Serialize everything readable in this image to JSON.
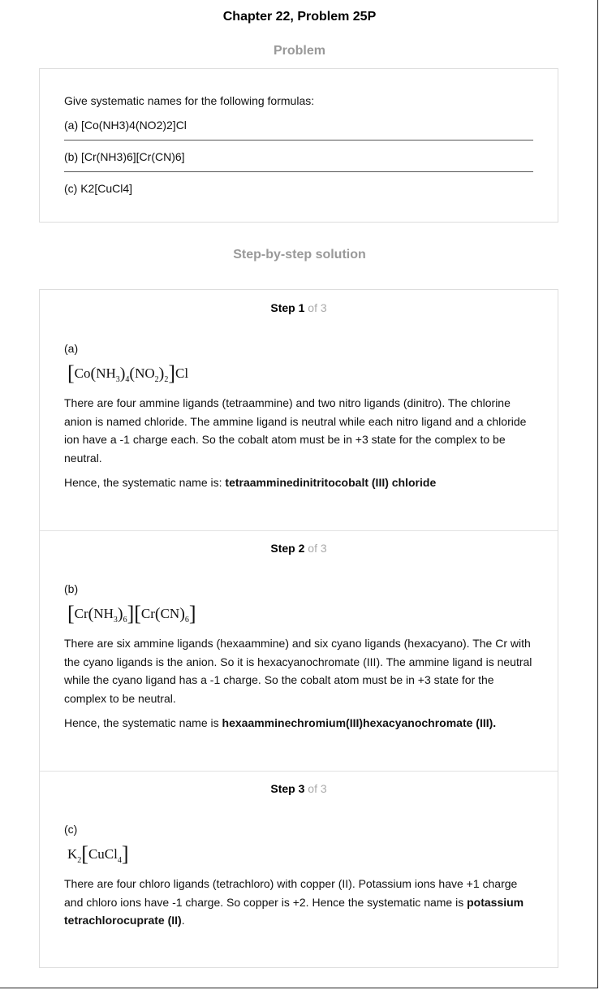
{
  "header": {
    "chapter_title": "Chapter 22, Problem 25P"
  },
  "problem": {
    "heading": "Problem",
    "intro": "Give systematic names for the following formulas:",
    "parts": [
      "(a) [Co(NH3)4(NO2)2]Cl",
      "(b) [Cr(NH3)6][Cr(CN)6]",
      "(c) K2[CuCl4]"
    ]
  },
  "solution": {
    "heading": "Step-by-step solution",
    "steps": [
      {
        "step_word": "Step",
        "number": "1",
        "of_total": "of 3",
        "part_label": "(a)",
        "formula": {
          "co": "Co",
          "nh3": "NH",
          "sub3": "3",
          "sub4": "4",
          "no2": "NO",
          "sub2a": "2",
          "sub2b": "2",
          "cl": "Cl"
        },
        "explanation": "There are four ammine ligands (tetraammine) and two nitro ligands (dinitro). The chlorine anion is named chloride. The ammine ligand is neutral while each nitro ligand and a chloride ion have a -1 charge each. So the cobalt atom must be in +3 state for the complex to be neutral.",
        "hence_prefix": "Hence, the systematic name is: ",
        "answer": "tetraamminedinitritocobalt (III) chloride",
        "hence_suffix": ""
      },
      {
        "step_word": "Step",
        "number": "2",
        "of_total": "of 3",
        "part_label": "(b)",
        "formula": {
          "cr1": "Cr",
          "nh3": "NH",
          "sub3": "3",
          "sub6a": "6",
          "cr2": "Cr",
          "cn": "CN",
          "sub6b": "6"
        },
        "explanation": "There are six ammine ligands (hexaammine) and six cyano ligands (hexacyano). The Cr with the cyano ligands is the anion. So it is hexacyanochromate (III). The ammine ligand is neutral while the cyano ligand has a -1 charge. So the cobalt atom must be in +3 state for the complex to be neutral.",
        "hence_prefix": "Hence, the systematic name is ",
        "answer": "hexaamminechromium(III)hexacyanochromate (III).",
        "hence_suffix": ""
      },
      {
        "step_word": "Step",
        "number": "3",
        "of_total": "of 3",
        "part_label": "(c)",
        "formula": {
          "k": "K",
          "sub2": "2",
          "cu": "CuCl",
          "sub4": "4"
        },
        "explanation_prefix": "There are four chloro ligands (tetrachloro) with copper (II). Potassium ions have +1 charge and chloro ions have -1 charge. So copper is +2. Hence the systematic name is ",
        "answer": "potassium tetrachlorocuprate (II)",
        "hence_suffix": "."
      }
    ]
  }
}
